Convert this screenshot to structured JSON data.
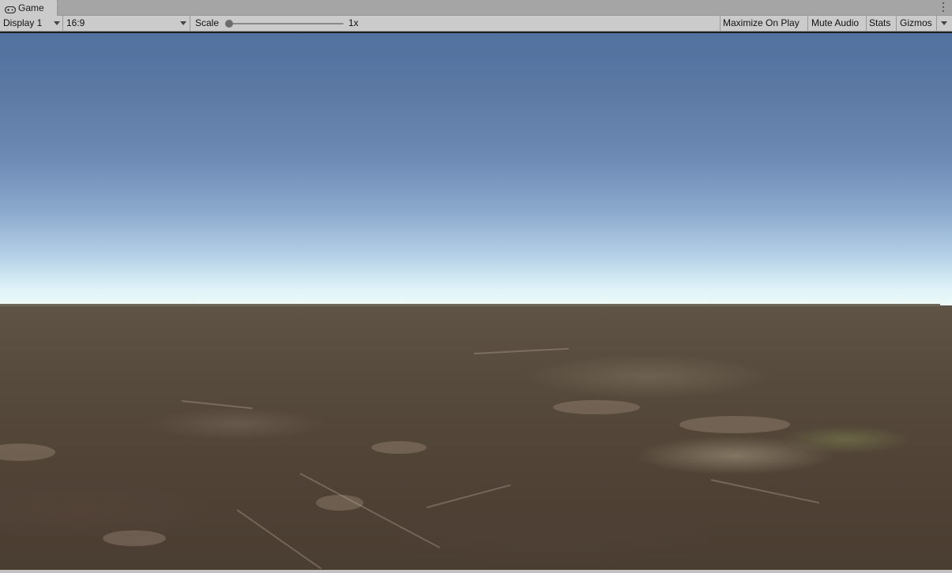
{
  "tab": {
    "title": "Game",
    "icon": "gamepad-icon"
  },
  "toolbar": {
    "display": "Display 1",
    "aspect": "16:9",
    "scale_label": "Scale",
    "scale_value": "1x",
    "maximize_on_play": "Maximize On Play",
    "mute_audio": "Mute Audio",
    "stats": "Stats",
    "gizmos": "Gizmos"
  },
  "colors": {
    "sky_top": "#51719f",
    "sky_horizon": "#edfaf7",
    "ground": "#54483a",
    "toolbar_bg": "#cbcbcb"
  }
}
